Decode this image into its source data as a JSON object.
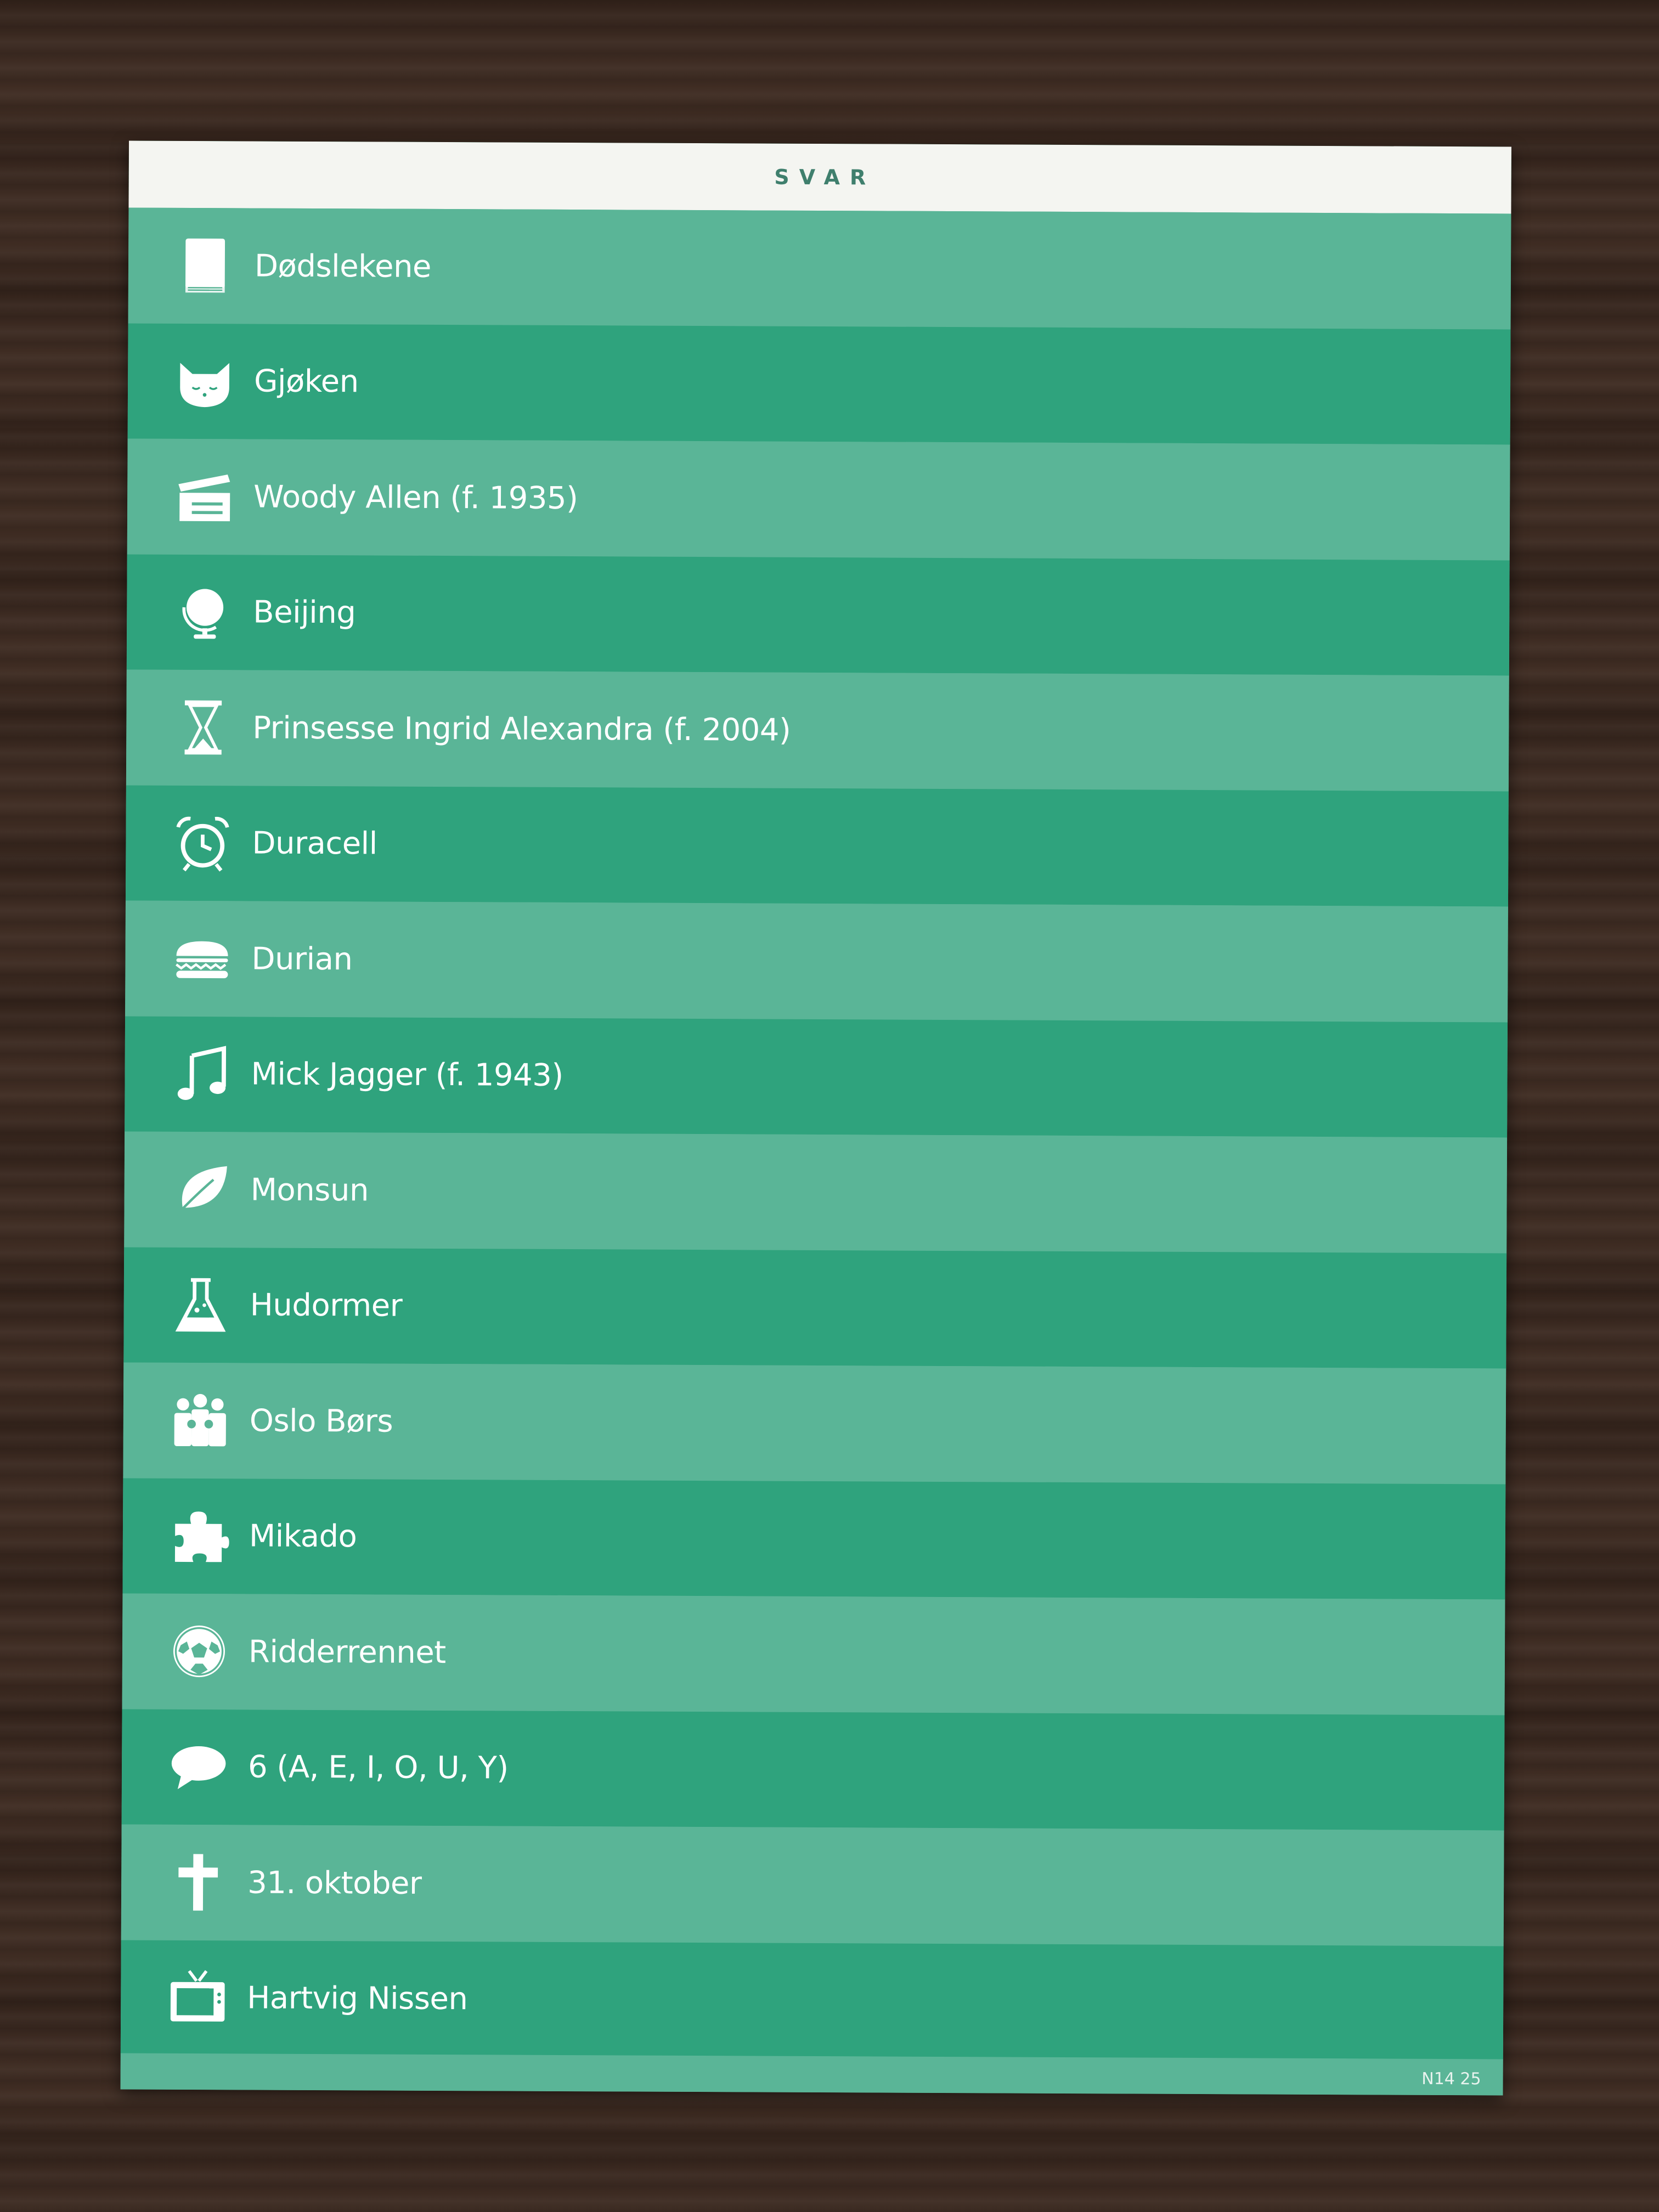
{
  "card": {
    "title": "SVAR",
    "code": "N14 25",
    "answers": [
      {
        "icon": "book-icon",
        "text": "Dødslekene"
      },
      {
        "icon": "cat-icon",
        "text": "Gjøken"
      },
      {
        "icon": "clapperboard-icon",
        "text": "Woody Allen (f. 1935)"
      },
      {
        "icon": "globe-icon",
        "text": "Beijing"
      },
      {
        "icon": "hourglass-icon",
        "text": "Prinsesse Ingrid Alexandra (f. 2004)"
      },
      {
        "icon": "alarm-clock-icon",
        "text": "Duracell"
      },
      {
        "icon": "burger-icon",
        "text": "Durian"
      },
      {
        "icon": "music-note-icon",
        "text": "Mick Jagger (f. 1943)"
      },
      {
        "icon": "leaf-icon",
        "text": "Monsun"
      },
      {
        "icon": "flask-icon",
        "text": "Hudormer"
      },
      {
        "icon": "people-icon",
        "text": "Oslo Børs"
      },
      {
        "icon": "puzzle-icon",
        "text": "Mikado"
      },
      {
        "icon": "soccer-ball-icon",
        "text": "Ridderrennet"
      },
      {
        "icon": "speech-bubble-icon",
        "text": "6 (A, E, I, O, U, Y)"
      },
      {
        "icon": "cross-icon",
        "text": "31. oktober"
      },
      {
        "icon": "tv-icon",
        "text": "Hartvig Nissen"
      }
    ]
  }
}
